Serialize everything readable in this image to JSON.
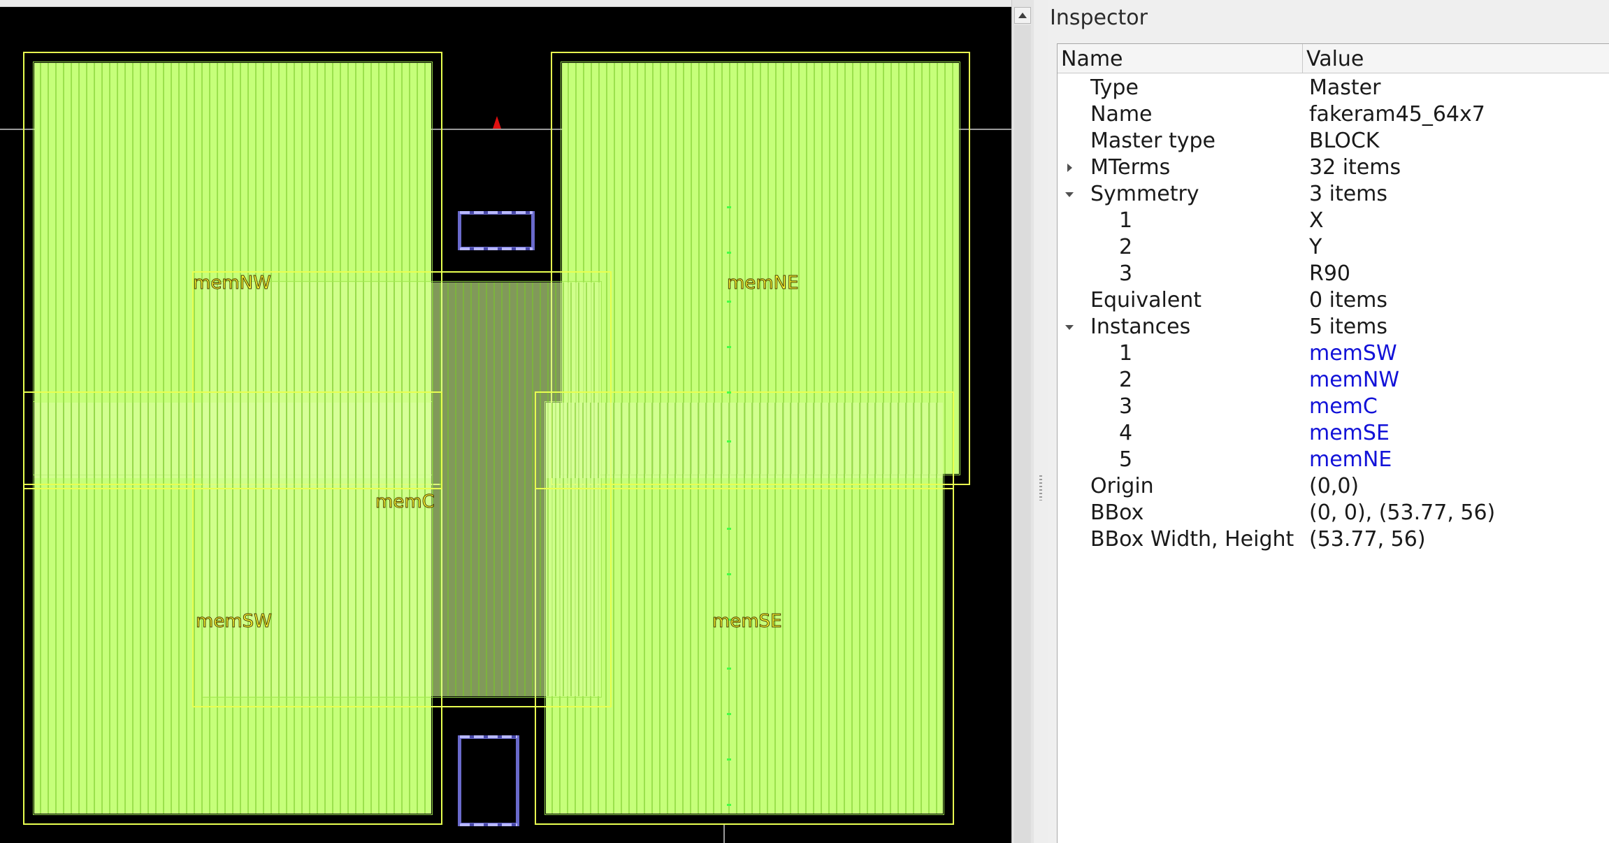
{
  "layout_view": {
    "instances": [
      {
        "name": "memNW"
      },
      {
        "name": "memNE"
      },
      {
        "name": "memC"
      },
      {
        "name": "memSW"
      },
      {
        "name": "memSE"
      }
    ],
    "colors": {
      "background": "#000000",
      "macro_fill": "#c6ff7a",
      "macro_outline": "#e8ff50",
      "label_text": "#ffff33",
      "io_pad": "#6a6acb",
      "marker": "#e01010"
    }
  },
  "inspector": {
    "title": "Inspector",
    "columns": {
      "name": "Name",
      "value": "Value"
    },
    "rows": [
      {
        "name": "Type",
        "value": "Master"
      },
      {
        "name": "Name",
        "value": "fakeram45_64x7"
      },
      {
        "name": "Master type",
        "value": "BLOCK"
      },
      {
        "name": "MTerms",
        "value": "32 items",
        "expander": "collapsed"
      },
      {
        "name": "Symmetry",
        "value": "3 items",
        "expander": "expanded"
      },
      {
        "name": "1",
        "value": "X"
      },
      {
        "name": "2",
        "value": "Y"
      },
      {
        "name": "3",
        "value": "R90"
      },
      {
        "name": "Equivalent",
        "value": "0 items"
      },
      {
        "name": "Instances",
        "value": "5 items",
        "expander": "expanded"
      },
      {
        "name": "1",
        "value": "memSW"
      },
      {
        "name": "2",
        "value": "memNW"
      },
      {
        "name": "3",
        "value": "memC"
      },
      {
        "name": "4",
        "value": "memSE"
      },
      {
        "name": "5",
        "value": "memNE"
      },
      {
        "name": "Origin",
        "value": "(0,0)"
      },
      {
        "name": "BBox",
        "value": "(0, 0), (53.77, 56)"
      },
      {
        "name": "BBox Width, Height",
        "value": "(53.77, 56)"
      }
    ],
    "link_color": "#1212d8"
  }
}
